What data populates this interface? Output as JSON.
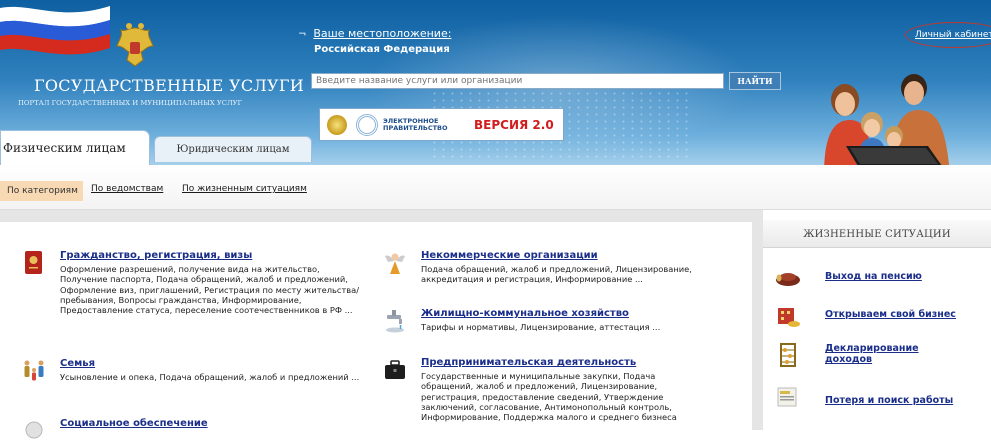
{
  "header": {
    "site_title": "ГОСУДАРСТВЕННЫЕ УСЛУГИ",
    "site_subtitle": "ПОРТАЛ ГОСУДАРСТВЕННЫХ И МУНИЦИПАЛЬНЫХ УСЛУГ",
    "location_label": "Ваше местоположение:",
    "location_value": "Российская Федерация",
    "search_placeholder": "Введите название услуги или организации",
    "search_button": "НАЙТИ",
    "banner_line1": "ЭЛЕКТРОННОЕ",
    "banner_line2": "ПРАВИТЕЛЬСТВО",
    "banner_version": "ВЕРСИЯ 2.0",
    "account_link": "Личный кабинет"
  },
  "tabs": {
    "individuals": "Физическим лицам",
    "legal": "Юридическим лицам"
  },
  "subnav": {
    "by_category": "По категориям",
    "by_department": "По ведомствам",
    "by_life_situation": "По жизненным ситуациям"
  },
  "services": [
    {
      "title": "Гражданство, регистрация, визы",
      "desc": "Оформление разрешений, получение вида на жительство, Получение паспорта, Подача обращений, жалоб и предложений, Оформление виз, приглашений, Регистрация по месту жительства/пребывания, Вопросы гражданства, Информирование, Предоставление статуса, переселение соотечественников в РФ ..."
    },
    {
      "title": "Некоммерческие организации",
      "desc": "Подача обращений, жалоб и предложений, Лицензирование, аккредитация и регистрация, Информирование ..."
    },
    {
      "title": "Жилищно-коммунальное хозяйство",
      "desc": "Тарифы и нормативы, Лицензирование, аттестация ..."
    },
    {
      "title": "Семья",
      "desc": "Усыновление и опека, Подача обращений, жалоб и предложений ..."
    },
    {
      "title": "Предпринимательская деятельность",
      "desc": "Государственные и муниципальные закупки, Подача обращений, жалоб и предложений, Лицензирование, регистрация, предоставление сведений, Утверждение заключений, согласование, Антимонопольный контроль, Информирование, Поддержка малого и среднего бизнеса"
    },
    {
      "title": "Социальное обеспечение",
      "desc": ""
    }
  ],
  "life_situations": {
    "heading": "ЖИЗНЕННЫЕ СИТУАЦИИ",
    "items": [
      {
        "label": "Выход на пенсию"
      },
      {
        "label": "Открываем свой бизнес"
      },
      {
        "label": "Декларирование доходов"
      },
      {
        "label": "Потеря и поиск работы"
      }
    ]
  },
  "colors": {
    "header_blue": "#1c6aaa",
    "link_blue": "#1a2e8a",
    "category_highlight": "#f7d9b4",
    "banner_red": "#d11d1d"
  }
}
